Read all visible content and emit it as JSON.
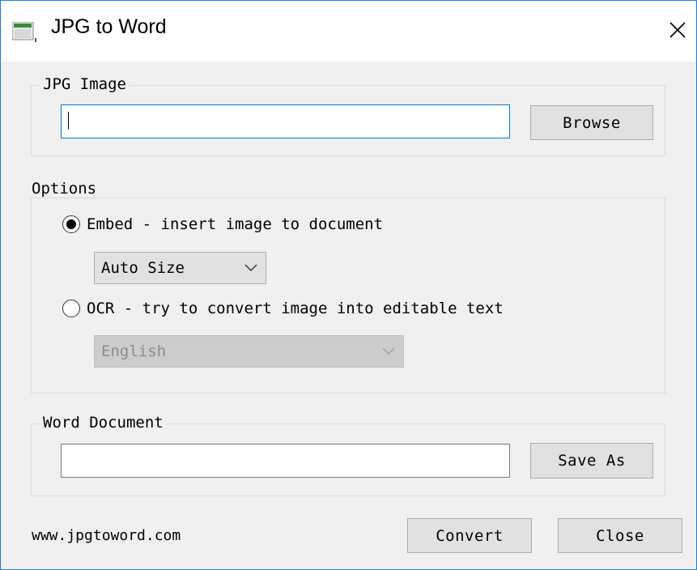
{
  "window": {
    "title": "JPG to Word"
  },
  "jpg_group": {
    "legend": "JPG Image",
    "path_value": "",
    "browse_label": "Browse"
  },
  "options_group": {
    "legend": "Options",
    "embed_label": "Embed - insert image to document",
    "embed_selected": true,
    "size_select_value": "Auto Size",
    "ocr_label": "OCR - try to convert image into editable text",
    "ocr_selected": false,
    "language_select_value": "English"
  },
  "word_group": {
    "legend": "Word Document",
    "path_value": "",
    "save_as_label": "Save As"
  },
  "footer": {
    "url": "www.jpgtoword.com",
    "convert_label": "Convert",
    "close_label": "Close"
  },
  "colors": {
    "focus_border": "#0078d7",
    "window_border": "#1e7bd8"
  }
}
